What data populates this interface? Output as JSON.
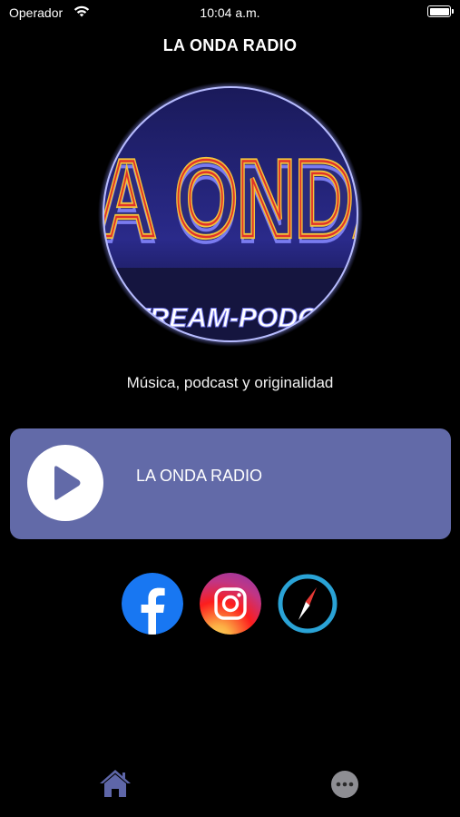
{
  "status_bar": {
    "carrier": "Operador",
    "time": "10:04 a.m.",
    "icons": [
      "wifi-icon",
      "battery-icon"
    ]
  },
  "header": {
    "title": "LA ONDA RADIO"
  },
  "logo": {
    "text_main": "LA ONDA",
    "text_sub": "STREAM-PODCAST"
  },
  "tagline": "Música, podcast y originalidad",
  "player": {
    "station_name": "LA ONDA RADIO",
    "play_icon": "play-icon",
    "card_color": "#626aa8"
  },
  "social": [
    {
      "name": "facebook",
      "icon": "facebook-icon"
    },
    {
      "name": "instagram",
      "icon": "instagram-icon"
    },
    {
      "name": "website",
      "icon": "compass-icon"
    }
  ],
  "tab_bar": {
    "items": [
      {
        "name": "home",
        "icon": "home-icon",
        "active": true
      },
      {
        "name": "more",
        "icon": "more-icon",
        "active": false
      }
    ],
    "active_color": "#5e66a8",
    "inactive_color": "#8e8e93"
  }
}
